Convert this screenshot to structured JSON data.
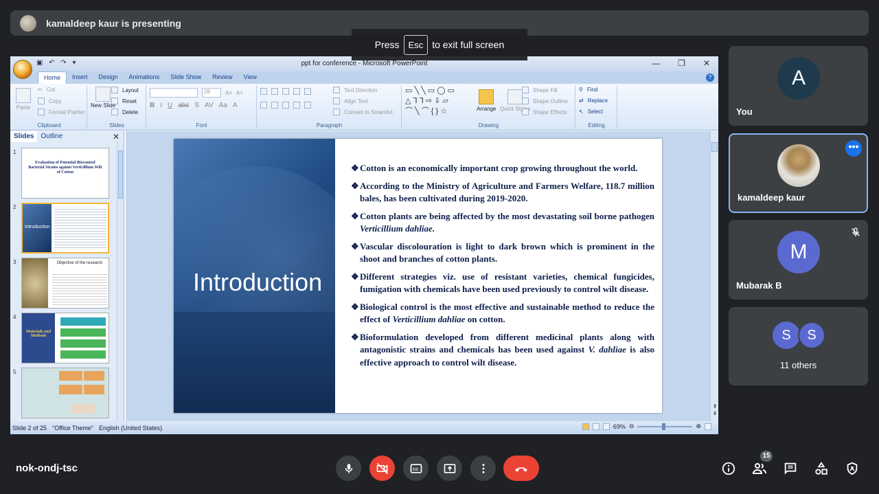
{
  "presenting": {
    "text": "kamaldeep kaur is presenting"
  },
  "toast": {
    "before": "Press",
    "key": "Esc",
    "after": "to exit full screen"
  },
  "powerpoint": {
    "window_title": "ppt for conference - Microsoft PowerPoint",
    "tabs": [
      "Home",
      "Insert",
      "Design",
      "Animations",
      "Slide Show",
      "Review",
      "View"
    ],
    "ribbon": {
      "clipboard": {
        "paste": "Paste",
        "cut": "Cut",
        "copy": "Copy",
        "format_painter": "Format Painter",
        "label": "Clipboard"
      },
      "slides": {
        "new_slide": "New Slide",
        "layout": "Layout",
        "reset": "Reset",
        "delete": "Delete",
        "label": "Slides"
      },
      "font": {
        "size": "28",
        "label": "Font"
      },
      "paragraph": {
        "text_direction": "Text Direction",
        "align_text": "Align Text",
        "convert": "Convert to SmartArt",
        "label": "Paragraph"
      },
      "drawing": {
        "arrange": "Arrange",
        "quick_styles": "Quick Styles",
        "shape_fill": "Shape Fill",
        "shape_outline": "Shape Outline",
        "shape_effects": "Shape Effects",
        "label": "Drawing"
      },
      "editing": {
        "find": "Find",
        "replace": "Replace",
        "select": "Select",
        "label": "Editing"
      }
    },
    "pane_tabs": {
      "slides": "Slides",
      "outline": "Outline"
    },
    "thumbnails": [
      {
        "num": "1",
        "title": "Evaluation of Potential Biocontrol Bacterial Strains against Verticillium Wilt of Cotton"
      },
      {
        "num": "2",
        "title": "Introduction"
      },
      {
        "num": "3",
        "title": "Objective of the research"
      },
      {
        "num": "4",
        "title": "Materials and Methods"
      },
      {
        "num": "5",
        "title": ""
      }
    ],
    "slide": {
      "title": "Introduction",
      "bullets": [
        {
          "text": "Cotton is an economically important crop growing throughout the world."
        },
        {
          "text": "According to the Ministry of Agriculture and Farmers Welfare, 118.7 million bales, has been cultivated during 2019-2020."
        },
        {
          "text": "Cotton plants are being affected by the most devastating soil borne pathogen ",
          "italic": "Verticillium dahliae.",
          "after": ""
        },
        {
          "text": "Vascular discolouration is light to dark brown which is prominent in the shoot and branches of cotton plants."
        },
        {
          "text": "Different strategies viz. use of resistant varieties, chemical fungicides, fumigation with chemicals have been used previously to control wilt disease."
        },
        {
          "text": "Biological control is the most effective and sustainable method to reduce the effect of ",
          "italic": "Verticillium dahliae",
          "after": " on cotton."
        },
        {
          "text": "Bioformulation developed from different medicinal plants along with antagonistic strains and chemicals has been used against ",
          "italic": "V. dahliae",
          "after": " is also effective approach to control wilt disease."
        }
      ]
    },
    "status": {
      "slide": "Slide 2 of 25",
      "theme": "\"Office Theme\"",
      "language": "English (United States)",
      "zoom": "69%"
    }
  },
  "participants": [
    {
      "name": "You",
      "initial": "A",
      "color": "#1e3a4c"
    },
    {
      "name": "kamaldeep kaur"
    },
    {
      "name": "Mubarak B",
      "initial": "M",
      "color": "#5b6ad0"
    },
    {
      "name": "11 others",
      "initials": [
        "S",
        "S"
      ],
      "colors": [
        "#5b6ad0",
        "#5b6ad0"
      ]
    }
  ],
  "meeting": {
    "code": "nok-ondj-tsc",
    "people_count": "15"
  }
}
